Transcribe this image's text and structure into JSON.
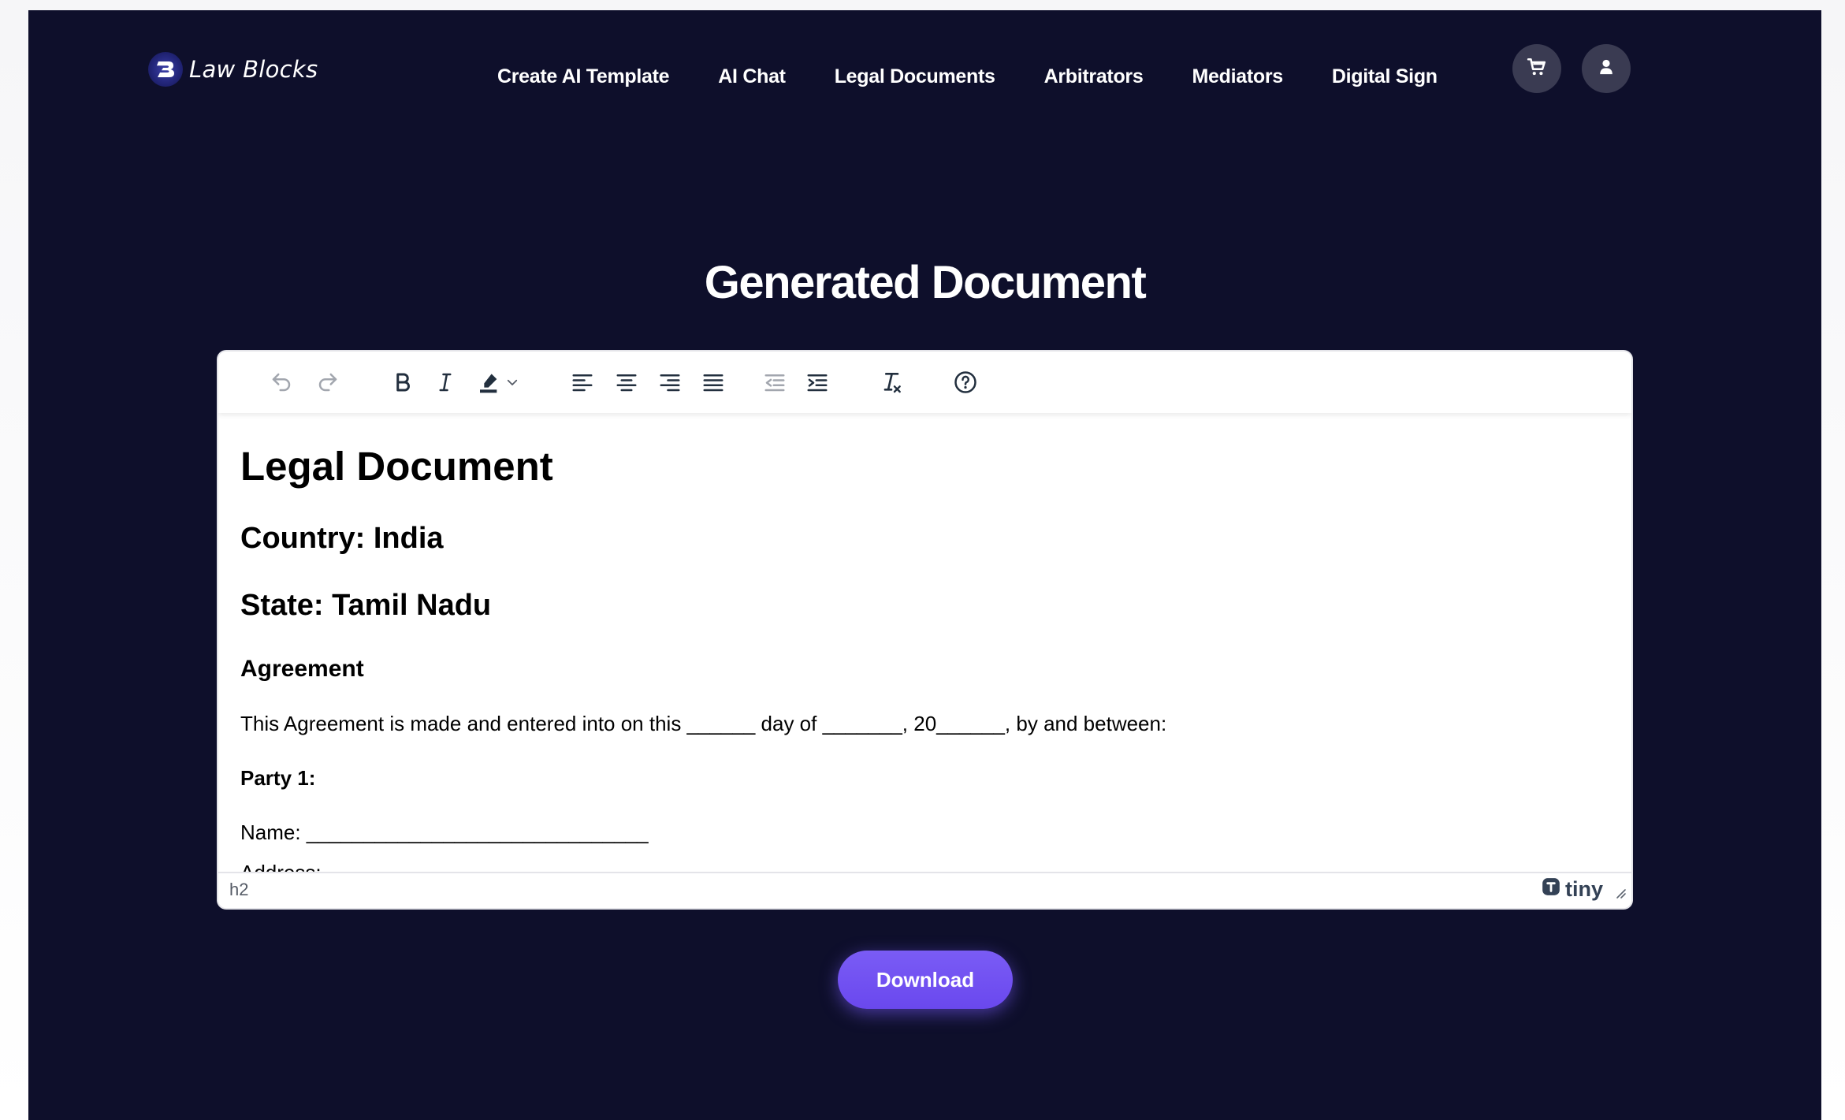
{
  "brand": {
    "name": "Law Blocks"
  },
  "nav": {
    "links": [
      {
        "label": "Create AI Template"
      },
      {
        "label": "AI Chat"
      },
      {
        "label": "Legal Documents"
      },
      {
        "label": "Arbitrators"
      },
      {
        "label": "Mediators"
      },
      {
        "label": "Digital Sign"
      }
    ],
    "icons": [
      "cart-icon",
      "user-icon"
    ]
  },
  "page": {
    "title": "Generated Document"
  },
  "editor": {
    "toolbar": [
      "undo-icon",
      "redo-icon",
      "bold-icon",
      "italic-icon",
      "highlight-icon",
      "chevron-down-icon",
      "align-left-icon",
      "align-center-icon",
      "align-right-icon",
      "align-justify-icon",
      "outdent-icon",
      "indent-icon",
      "clear-formatting-icon",
      "help-icon"
    ],
    "document": {
      "heading": "Legal Document",
      "country": "Country: India",
      "state": "State: Tamil Nadu",
      "section": "Agreement",
      "intro": "This Agreement is made and entered into on this ______ day of _______, 20______, by and between:",
      "party_label": "Party 1:",
      "name_line": "Name: ______________________________",
      "address_partial": "Address:"
    },
    "statusbar": {
      "path": "h2",
      "branding": "tiny"
    }
  },
  "actions": {
    "download_label": "Download"
  },
  "colors": {
    "background": "#0e0f2b",
    "accent": "#6f4ff2",
    "icon_button": "#3a3b52"
  }
}
